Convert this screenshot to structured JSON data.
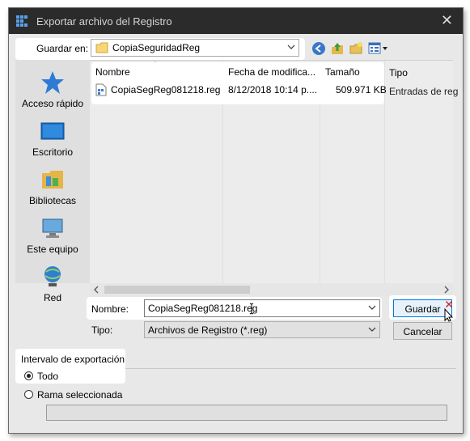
{
  "window": {
    "title": "Exportar archivo del Registro",
    "close_glyph": "✕"
  },
  "save_in": {
    "label": "Guardar en:",
    "folder": "CopiaSeguridadReg"
  },
  "toolbar": {
    "icons": [
      "back-icon",
      "up-folder-icon",
      "new-folder-icon",
      "view-menu-icon"
    ]
  },
  "places": [
    {
      "label": "Acceso rápido",
      "icon": "star-icon"
    },
    {
      "label": "Escritorio",
      "icon": "desktop-icon"
    },
    {
      "label": "Bibliotecas",
      "icon": "libraries-icon"
    },
    {
      "label": "Este equipo",
      "icon": "computer-icon"
    },
    {
      "label": "Red",
      "icon": "network-icon"
    }
  ],
  "file_list": {
    "columns": [
      "Nombre",
      "Fecha de modifica...",
      "Tamaño",
      "Tipo"
    ],
    "rows": [
      {
        "name": "CopiaSegReg081218.reg",
        "date": "8/12/2018 10:14 p....",
        "size": "509.971 KB",
        "type": "Entradas de reg"
      }
    ]
  },
  "form": {
    "name_label": "Nombre:",
    "name_value": "CopiaSegReg081218.reg",
    "type_label": "Tipo:",
    "type_value": "Archivos de Registro (*.reg)",
    "save_button": "Guardar",
    "cancel_button": "Cancelar"
  },
  "export_range": {
    "title": "Intervalo de exportación",
    "option_all": "Todo",
    "option_branch": "Rama seleccionada",
    "selected": "Todo"
  }
}
